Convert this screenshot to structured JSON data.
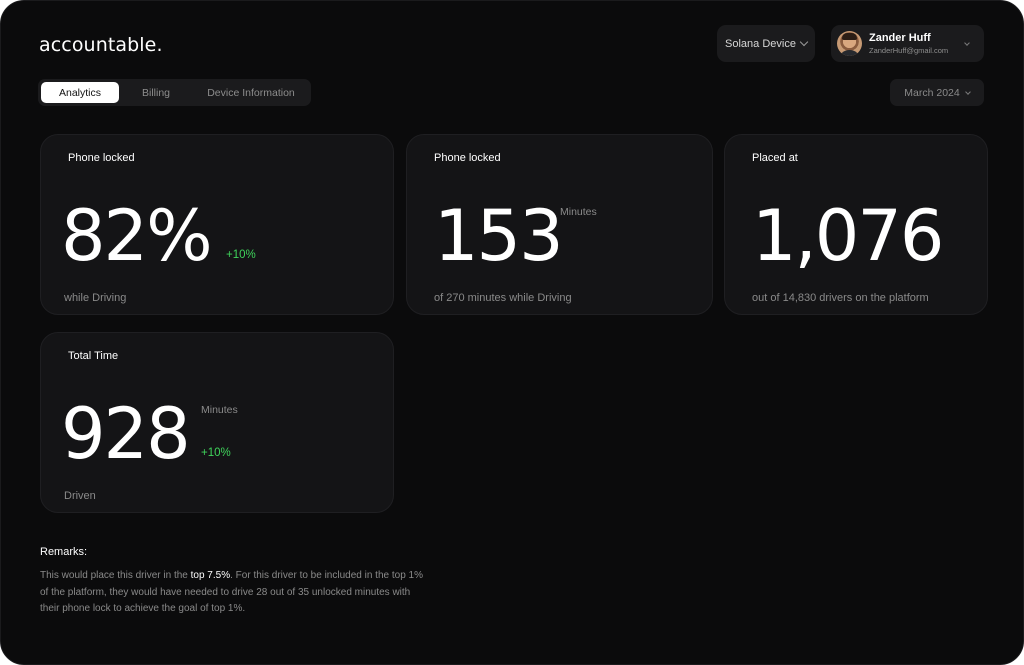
{
  "app": {
    "logo": "accountable."
  },
  "header": {
    "device_select": "Solana Device",
    "user": {
      "name": "Zander Huff",
      "email": "ZanderHuff@gmail.com"
    },
    "month_select": "March 2024"
  },
  "tabs": [
    {
      "label": "Analytics",
      "active": true
    },
    {
      "label": "Billing",
      "active": false
    },
    {
      "label": "Device Information",
      "active": false
    }
  ],
  "cards": [
    {
      "title": "Phone locked",
      "value": "82%",
      "unit": "",
      "delta": "+10%",
      "subtitle": "while Driving"
    },
    {
      "title": "Phone locked",
      "value": "153",
      "unit": "Minutes",
      "delta": "",
      "subtitle": "of 270 minutes while Driving"
    },
    {
      "title": "Placed at",
      "value": "1,076",
      "unit": "",
      "delta": "",
      "subtitle": "out of 14,830 drivers on the platform"
    },
    {
      "title": "Total Time",
      "value": "928",
      "unit": "Minutes",
      "delta": "+10%",
      "subtitle": "Driven"
    }
  ],
  "remarks": {
    "title": "Remarks:",
    "text_before": "This would place this driver in the ",
    "highlight": "top 7.5%",
    "text_after": ". For this driver to be included in the top 1% of the platform, they would have needed to drive 28 out of 35 unlocked minutes with their phone lock to achieve the goal of top 1%."
  },
  "colors": {
    "background": "#0b0b0c",
    "card": "#141416",
    "positive": "#3fd35b",
    "muted_text": "#8a8a8a"
  }
}
